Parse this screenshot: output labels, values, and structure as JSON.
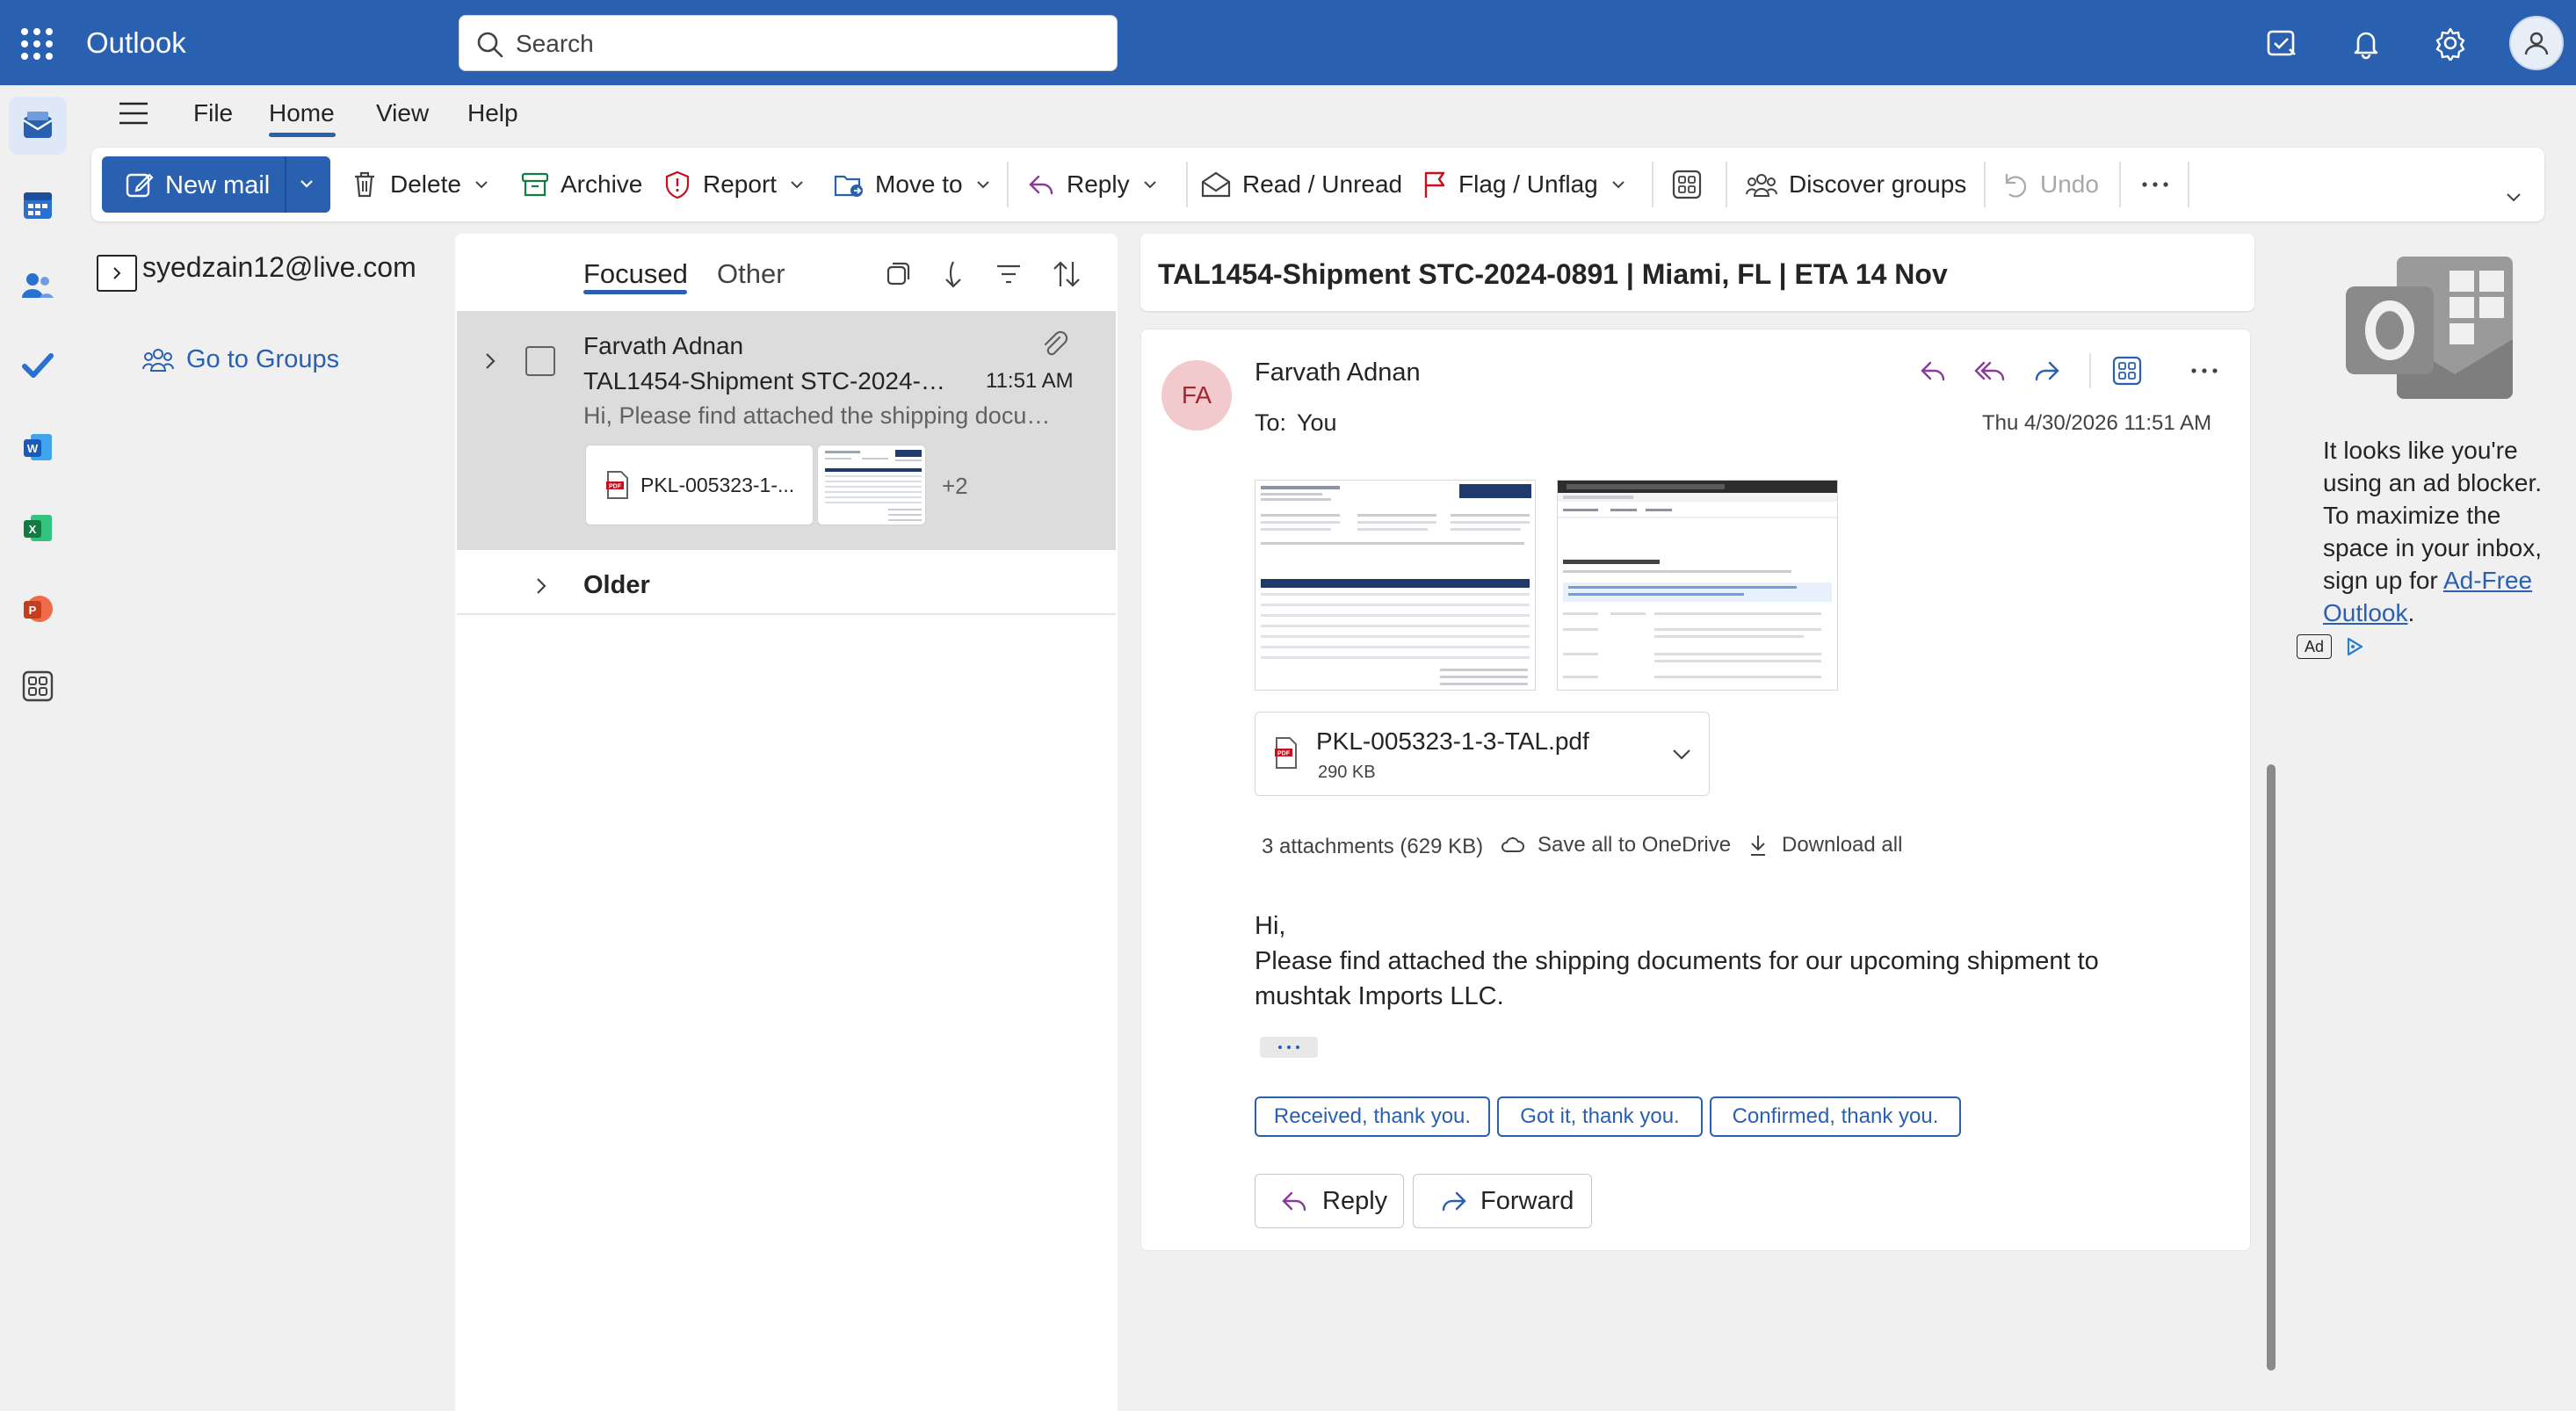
{
  "app": {
    "name": "Outlook"
  },
  "search": {
    "placeholder": "Search"
  },
  "ribbon": {
    "tabs": [
      "File",
      "Home",
      "View",
      "Help"
    ],
    "active_tab": "Home",
    "buttons": {
      "new_mail": "New mail",
      "delete": "Delete",
      "archive": "Archive",
      "report": "Report",
      "move_to": "Move to",
      "reply": "Reply",
      "read_unread": "Read / Unread",
      "flag_unflag": "Flag / Unflag",
      "discover_groups": "Discover groups",
      "undo": "Undo"
    }
  },
  "folder_pane": {
    "account": "syedzain12@live.com",
    "go_to_groups": "Go to Groups"
  },
  "message_list": {
    "tabs": {
      "focused": "Focused",
      "other": "Other"
    },
    "messages": [
      {
        "sender": "Farvath Adnan",
        "subject": "TAL1454-Shipment STC-2024-0891 | Miami, FL | ETA 14 Nov",
        "time": "11:51 AM",
        "preview": "Hi, Please find attached the shipping documents for our upcoming shipment to mushtak Imports LLC.",
        "attachment_chip": "PKL-005323-1-...",
        "more_attachments": "+2"
      }
    ],
    "older_group": "Older"
  },
  "reading_pane": {
    "subject": "TAL1454-Shipment STC-2024-0891 | Miami, FL | ETA 14 Nov",
    "sender_initials": "FA",
    "sender": "Farvath Adnan",
    "to_label": "To:",
    "to": "You",
    "date": "Thu 4/30/2026 11:51 AM",
    "attachment": {
      "name": "PKL-005323-1-3-TAL.pdf",
      "size": "290 KB"
    },
    "attachments_summary": "3 attachments (629 KB)",
    "save_all": "Save all to OneDrive",
    "download_all": "Download all",
    "body": [
      "Hi,",
      "Please find attached the shipping documents for our upcoming shipment to",
      "mushtak Imports LLC."
    ],
    "quick_replies": [
      "Received, thank you.",
      "Got it, thank you.",
      "Confirmed, thank you."
    ],
    "reply_button": "Reply",
    "forward_button": "Forward"
  },
  "ad_pane": {
    "text": "It looks like you're using an ad blocker. To maximize the space in your inbox, sign up for ",
    "link": "Ad-Free Outlook",
    "link_suffix": ".",
    "badge": "Ad"
  },
  "colors": {
    "brand_blue": "#2a60b0",
    "avatar_bg": "#f2c9cc",
    "avatar_fg": "#a4262c",
    "selected_row": "#dcdcdc"
  }
}
